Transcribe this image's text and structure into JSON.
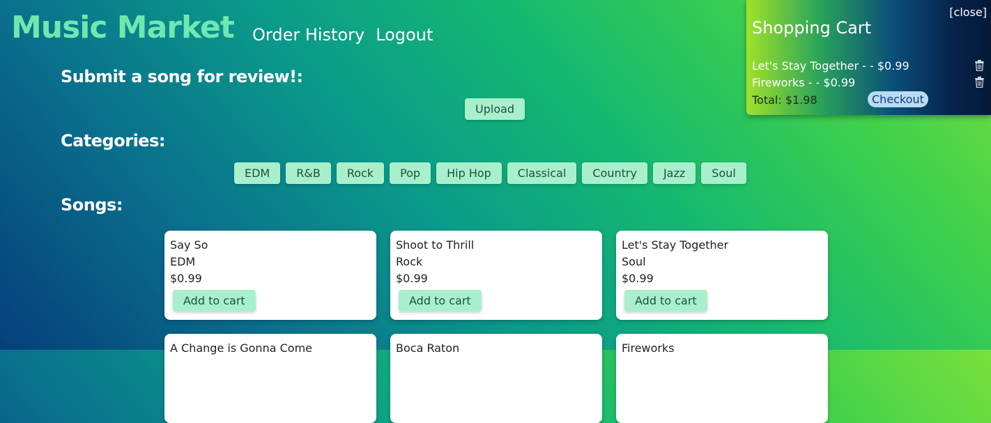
{
  "app": {
    "title": "Music Market"
  },
  "nav": {
    "order_history": "Order History",
    "logout": "Logout"
  },
  "submit": {
    "heading": "Submit a song for review!:",
    "upload_label": "Upload"
  },
  "categories": {
    "heading": "Categories:",
    "items": [
      "EDM",
      "R&B",
      "Rock",
      "Pop",
      "Hip Hop",
      "Classical",
      "Country",
      "Jazz",
      "Soul"
    ]
  },
  "songs": {
    "heading": "Songs:",
    "add_label": "Add to cart",
    "items": [
      {
        "title": "Say So",
        "genre": "EDM",
        "price": "$0.99"
      },
      {
        "title": "Shoot to Thrill",
        "genre": "Rock",
        "price": "$0.99"
      },
      {
        "title": "Let's Stay Together",
        "genre": "Soul",
        "price": "$0.99"
      },
      {
        "title": "A Change is Gonna Come",
        "genre": "",
        "price": ""
      },
      {
        "title": "Boca Raton",
        "genre": "",
        "price": ""
      },
      {
        "title": "Fireworks",
        "genre": "",
        "price": ""
      }
    ]
  },
  "cart": {
    "close_label": "[close]",
    "title": "Shopping Cart",
    "items": [
      {
        "label": "Let's Stay Together - - $0.99",
        "icon": "trash-icon"
      },
      {
        "label": "Fireworks - - $0.99",
        "icon": "trash-icon"
      }
    ],
    "total": "Total: $1.98",
    "checkout_label": "Checkout"
  },
  "colors": {
    "brand": "#6fe8b0",
    "button": "#a8f0cc",
    "checkout": "#b9dcf0"
  }
}
